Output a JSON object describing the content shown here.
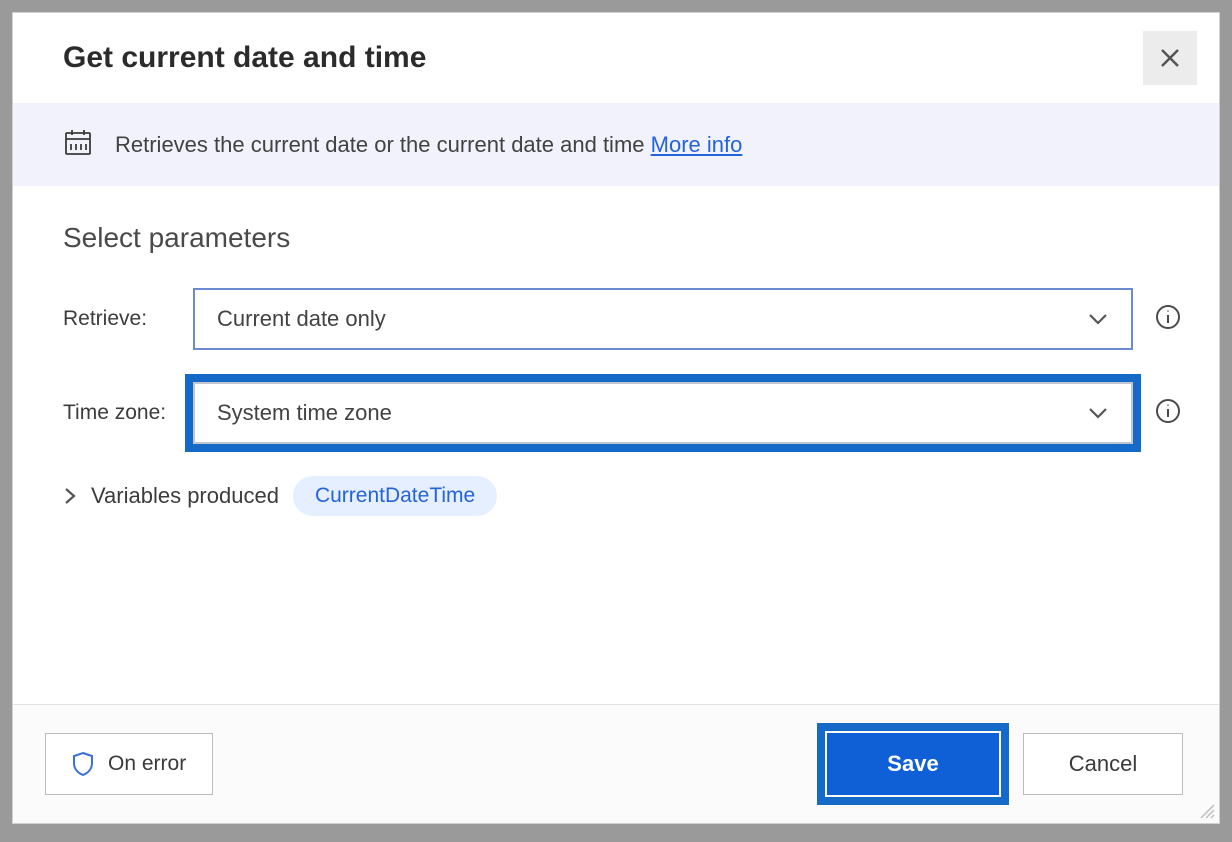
{
  "dialog": {
    "title": "Get current date and time",
    "info_text": "Retrieves the current date or the current date and time",
    "info_link_label": "More info"
  },
  "parameters": {
    "section_title": "Select parameters",
    "fields": {
      "retrieve": {
        "label": "Retrieve:",
        "value": "Current date only"
      },
      "timezone": {
        "label": "Time zone:",
        "value": "System time zone"
      }
    },
    "variables": {
      "label": "Variables produced",
      "chip": "CurrentDateTime"
    }
  },
  "footer": {
    "on_error_label": "On error",
    "save_label": "Save",
    "cancel_label": "Cancel"
  }
}
